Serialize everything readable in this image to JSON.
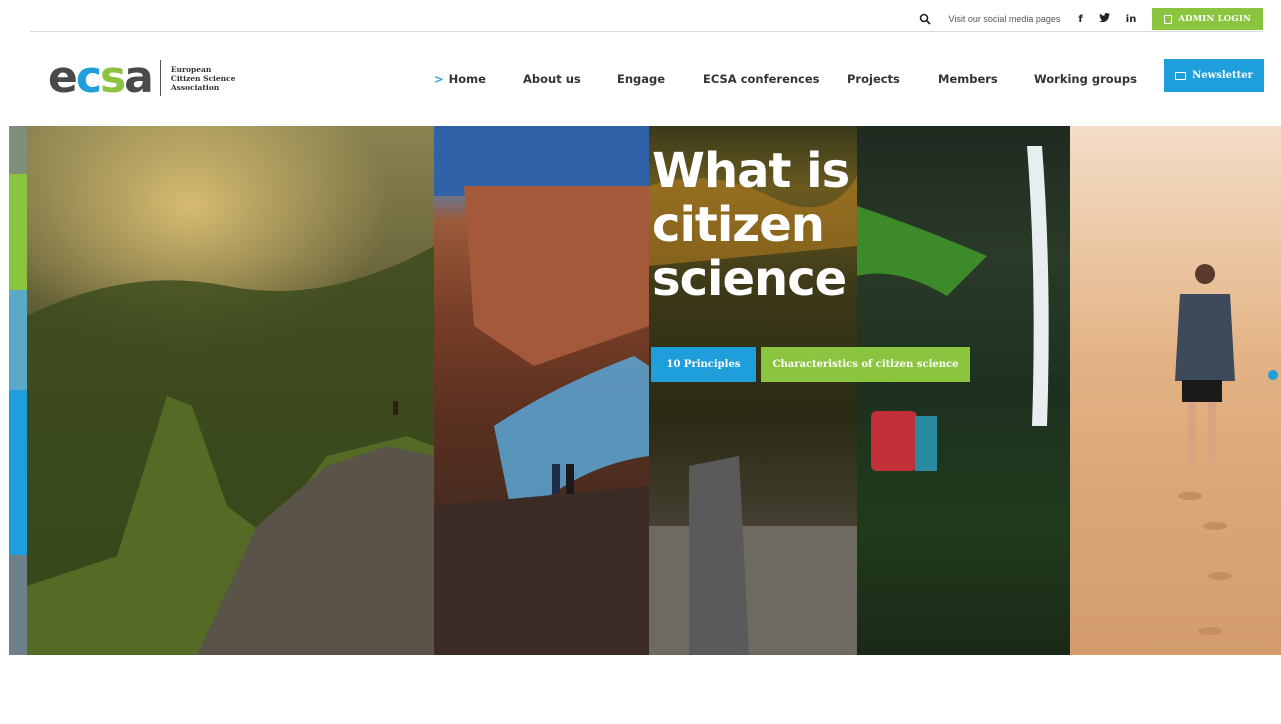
{
  "topbar": {
    "social_text": "Visit our social media pages",
    "social_icons": [
      "f",
      "𝑾",
      "in"
    ],
    "admin_label": "ADMIN LOGIN"
  },
  "logo": {
    "word_letters": [
      "e",
      "c",
      "s",
      "a"
    ],
    "word_colors": [
      "#4a4a4a",
      "#1e9fdb",
      "#8bc53f",
      "#4a4a4a"
    ],
    "sub": [
      "European",
      "Citizen Science",
      "Association"
    ]
  },
  "nav": {
    "items": [
      {
        "label": "Home",
        "active": true
      },
      {
        "label": "About us"
      },
      {
        "label": "Engage"
      },
      {
        "label": "ECSA conferences"
      },
      {
        "label": "Projects"
      },
      {
        "label": "Members"
      },
      {
        "label": "Working groups"
      }
    ],
    "newsletter_label": "Newsletter"
  },
  "hero": {
    "title_lines": [
      "What is",
      "citizen",
      "science"
    ],
    "button_principles": "10 Principles",
    "button_characteristics": "Characteristics of citizen science"
  },
  "colors": {
    "blue": "#1e9fdb",
    "green": "#8bc53f"
  }
}
